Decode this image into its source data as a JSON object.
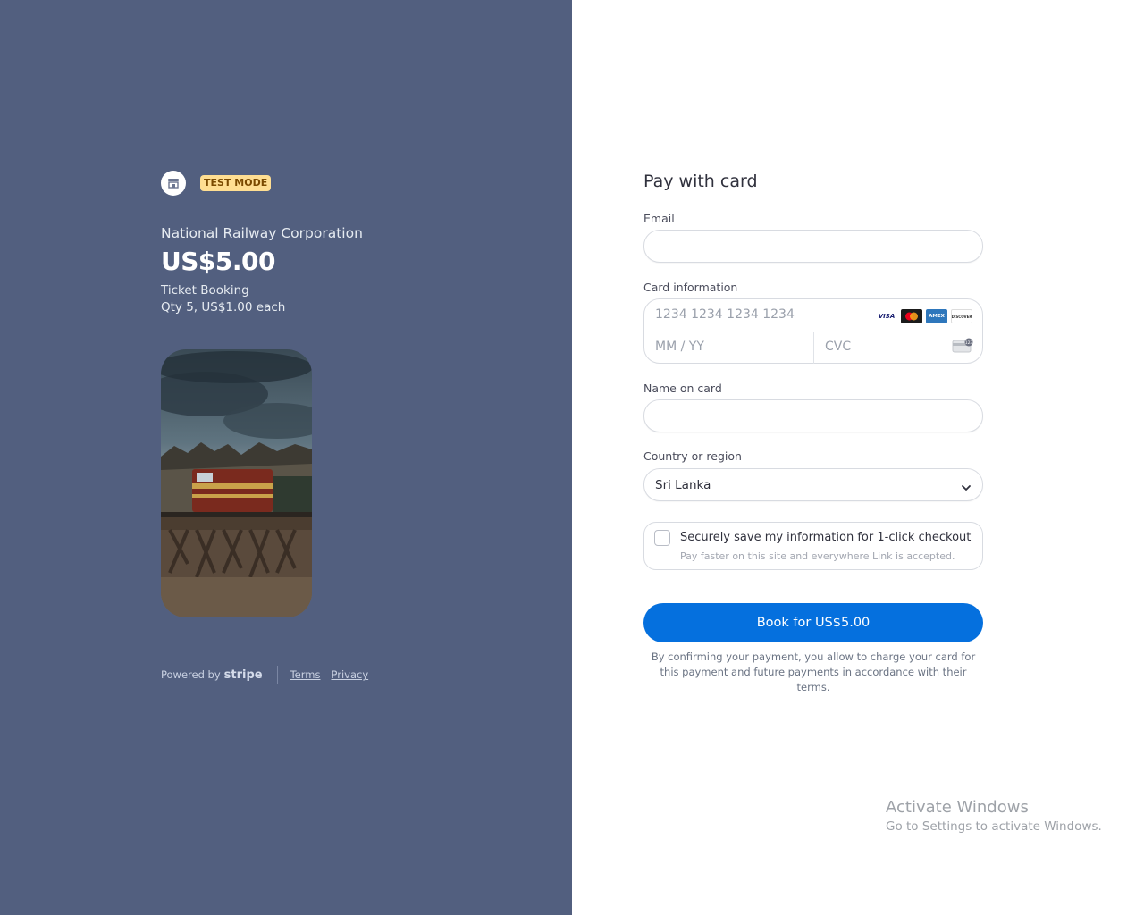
{
  "summary": {
    "test_mode_label": "TEST MODE",
    "merchant_name": "National Railway Corporation",
    "price": "US$5.00",
    "product_name": "Ticket Booking",
    "product_qty": "Qty 5, US$1.00 each"
  },
  "footer": {
    "powered_by": "Powered by",
    "stripe": "stripe",
    "terms": "Terms",
    "privacy": "Privacy"
  },
  "form": {
    "title": "Pay with card",
    "email_label": "Email",
    "email_value": "",
    "card_label": "Card information",
    "card_number_placeholder": "1234 1234 1234 1234",
    "expiry_placeholder": "MM / YY",
    "cvc_placeholder": "CVC",
    "card_brands": [
      "VISA",
      "mastercard",
      "AMEX",
      "DISCOVER"
    ],
    "name_label": "Name on card",
    "name_value": "",
    "country_label": "Country or region",
    "country_value": "Sri Lanka",
    "save_title": "Securely save my information for 1-click checkout",
    "save_subtitle": "Pay faster on this site and everywhere Link is accepted.",
    "pay_button": "Book for US$5.00",
    "terms_text": "By confirming your payment, you allow to charge your card for this payment and future payments in accordance with their terms."
  },
  "watermark": {
    "title": "Activate Windows",
    "subtitle": "Go to Settings to activate Windows."
  },
  "colors": {
    "left_bg": "#525f7f",
    "pay_button": "#0570de",
    "test_badge": "#ffde92"
  }
}
